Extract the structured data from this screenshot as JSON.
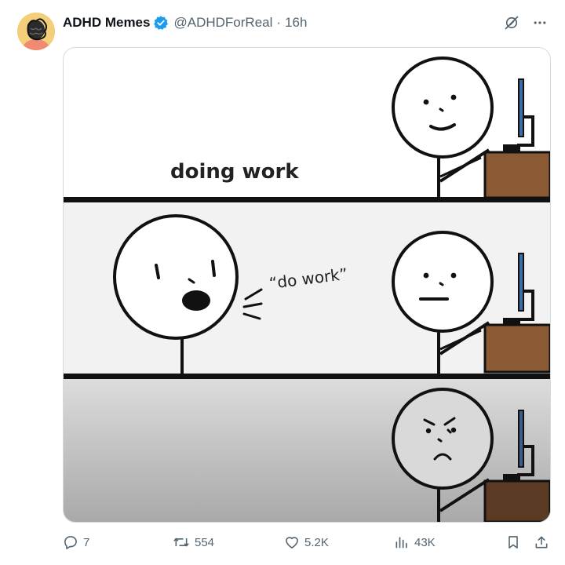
{
  "post": {
    "author_name": "ADHD Memes",
    "handle": "@ADHDForReal",
    "separator": "·",
    "time": "16h"
  },
  "meme": {
    "panel1_caption": "doing work",
    "panel2_quote": "“do work”"
  },
  "stats": {
    "replies": "7",
    "reposts": "554",
    "likes": "5.2K",
    "views": "43K"
  },
  "colors": {
    "verified_blue": "#1d9bf0",
    "muted_text": "#536471",
    "desk_brown": "#8a5a34",
    "avatar_yellow": "#f4cf7a"
  },
  "icons": {
    "verified": "verified-badge-icon",
    "grok": "grok-icon",
    "more": "more-icon",
    "reply": "reply-icon",
    "repost": "repost-icon",
    "like": "like-icon",
    "views": "views-icon",
    "bookmark": "bookmark-icon",
    "share": "share-icon"
  }
}
